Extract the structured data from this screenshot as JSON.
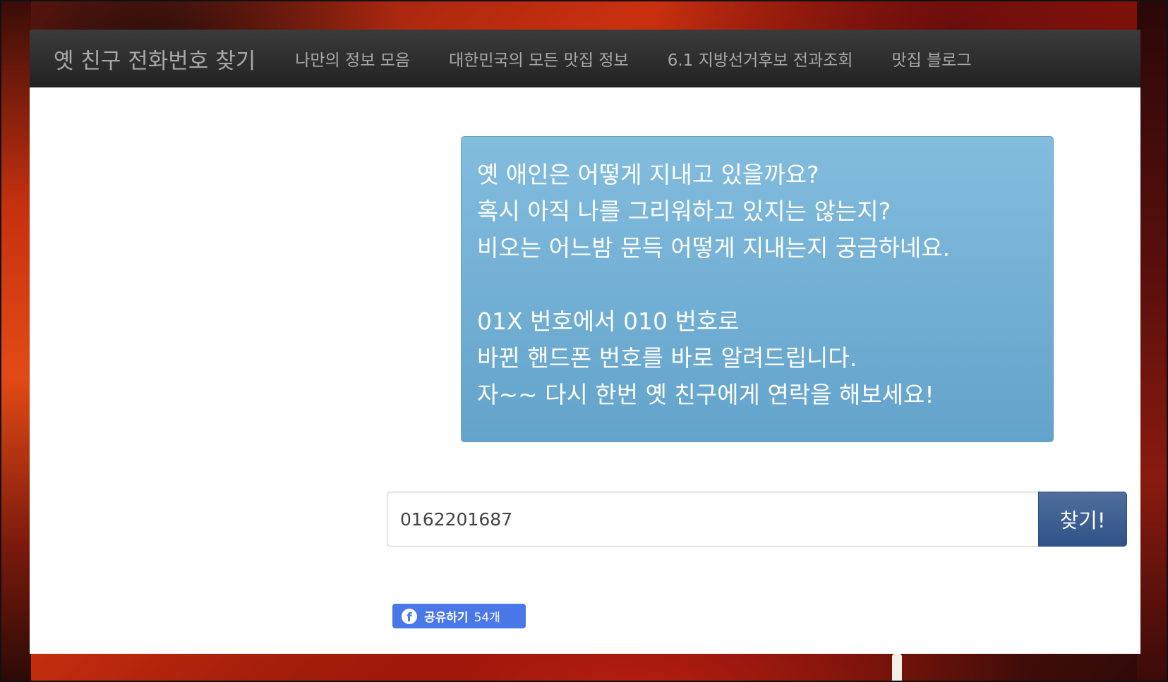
{
  "navbar": {
    "brand": "옛 친구 전화번호 찾기",
    "items": [
      {
        "label": "나만의 정보 모음"
      },
      {
        "label": "대한민국의 모든 맛집 정보"
      },
      {
        "label": "6.1 지방선거후보 전과조회"
      },
      {
        "label": "맛집 블로그"
      }
    ]
  },
  "info": {
    "lines": [
      "옛 애인은 어떻게 지내고 있을까요?",
      "혹시 아직 나를 그리워하고 있지는 않는지?",
      "비오는 어느밤 문득 어떻게 지내는지 궁금하네요.",
      "",
      "01X 번호에서 010 번호로",
      "바뀐 핸드폰 번호를 바로 알려드립니다.",
      "자~~ 다시 한번 옛 친구에게 연락을 해보세요!"
    ]
  },
  "search": {
    "value": "0162201687",
    "button_label": "찾기!"
  },
  "share": {
    "icon": "facebook-icon",
    "label": "공유하기",
    "count": "54개"
  },
  "colors": {
    "navbar": "#2b2b2b",
    "info_box": "#6eaed4",
    "button": "#3a5d92",
    "facebook": "#4a78e8"
  }
}
